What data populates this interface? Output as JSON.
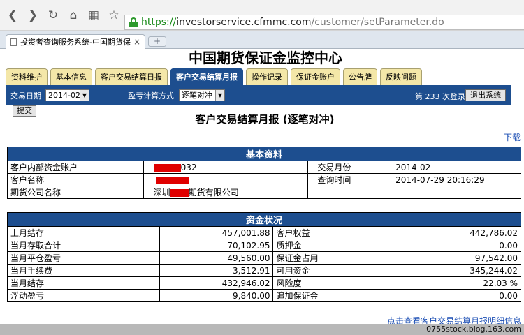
{
  "browser": {
    "url_scheme": "https://",
    "url_host": "investorservice.cfmmc.com",
    "url_path": "/customer/setParameter.do",
    "tab_title": "投资者查询服务系统-中国期货保",
    "new_tab_label": "+"
  },
  "site": {
    "title": "中国期货保证金监控中心",
    "tabs": [
      {
        "label": "资料维护"
      },
      {
        "label": "基本信息"
      },
      {
        "label": "客户交易结算日报"
      },
      {
        "label": "客户交易结算月报"
      },
      {
        "label": "操作记录"
      },
      {
        "label": "保证金账户"
      },
      {
        "label": "公告牌"
      },
      {
        "label": "反映问题"
      }
    ]
  },
  "toolbar": {
    "date_label": "交易日期",
    "date_value": "2014-02",
    "method_label": "盈亏计算方式",
    "method_value": "逐笔对冲",
    "login_prefix": "第",
    "login_count": "233",
    "login_suffix": "次登录",
    "logout_label": "退出系统",
    "submit_label": "提交"
  },
  "report": {
    "title": "客户交易结算月报 (逐笔对冲)",
    "download_label": "下载",
    "basic": {
      "heading": "基本资料",
      "account_label": "客户内部资金账户",
      "account_value_tail": "032",
      "month_label": "交易月份",
      "month_value": "2014-02",
      "name_label": "客户名称",
      "query_time_label": "查询时间",
      "query_time_value": "2014-07-29 20:16:29",
      "company_label": "期货公司名称",
      "company_prefix": "深圳",
      "company_suffix": "期货有限公司"
    },
    "funds": {
      "heading": "资金状况",
      "rows": [
        {
          "l_label": "上月结存",
          "l_value": "457,001.88",
          "r_label": "客户权益",
          "r_value": "442,786.02"
        },
        {
          "l_label": "当月存取合计",
          "l_value": "-70,102.95",
          "r_label": "质押金",
          "r_value": "0.00"
        },
        {
          "l_label": "当月平仓盈亏",
          "l_value": "49,560.00",
          "r_label": "保证金占用",
          "r_value": "97,542.00"
        },
        {
          "l_label": "当月手续费",
          "l_value": "3,512.91",
          "r_label": "可用资金",
          "r_value": "345,244.02"
        },
        {
          "l_label": "当月结存",
          "l_value": "432,946.02",
          "r_label": "风险度",
          "r_value": "22.03 %"
        },
        {
          "l_label": "浮动盈亏",
          "l_value": "9,840.00",
          "r_label": "追加保证金",
          "r_value": "0.00"
        }
      ]
    },
    "detail_link": "点击查看客户交易结算月报明细信息"
  },
  "footer": {
    "watermark": "0755stock.blog.163.com"
  },
  "colors": {
    "accent_blue": "#1d4e8f",
    "tab_yellow": "#f4e7a8",
    "redaction": "#e00000"
  }
}
